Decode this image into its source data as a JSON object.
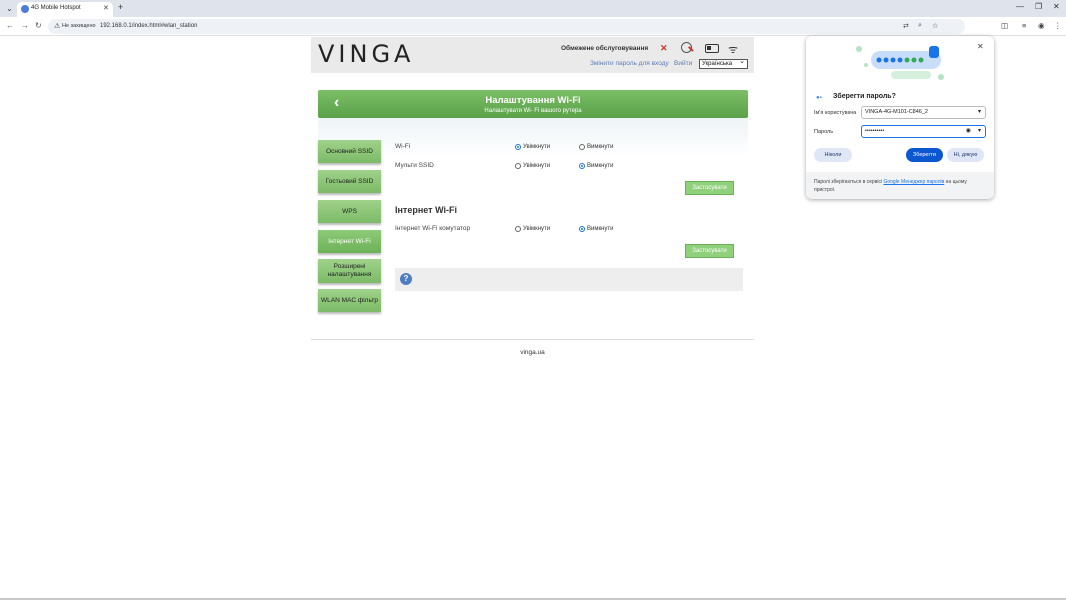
{
  "browser": {
    "tab_title": "4G Mobile Hotspot",
    "tab_close": "✕",
    "new_tab": "+",
    "security_label": "Не захищено",
    "url": "192.168.0.1/index.html#wlan_station",
    "win_min": "—",
    "win_max": "❐",
    "win_close": "✕"
  },
  "header": {
    "logo": "VINGA",
    "limited_service": "Обмежене обслуговування",
    "change_password": "Змінити пароль для входу",
    "logout": "Вийти",
    "language": "Українська"
  },
  "banner": {
    "title": "Налаштування Wi-Fi",
    "subtitle": "Налаштувати Wi- Fi вашого рутера"
  },
  "sidebar": {
    "items": [
      {
        "label": "Основний SSID"
      },
      {
        "label": "Гостьовий SSID"
      },
      {
        "label": "WPS"
      },
      {
        "label": "Інтернет Wi-Fi"
      },
      {
        "label": "Розширені налаштування"
      },
      {
        "label": "WLAN MAC фільтр"
      }
    ]
  },
  "wifi_settings": {
    "rows": [
      {
        "label": "Wi-Fi",
        "on": "Увімкнути",
        "off": "Вимкнути",
        "selected": "on"
      },
      {
        "label": "Мульти SSID",
        "on": "Увімкнути",
        "off": "Вимкнути",
        "selected": "off"
      }
    ],
    "apply": "Застосувати"
  },
  "internet_wifi": {
    "title": "Інтернет Wi-Fi",
    "row": {
      "label": "Інтернет Wi-Fi комутатор",
      "on": "Увімкнути",
      "off": "Вимкнути",
      "selected": "off"
    },
    "apply": "Застосувати"
  },
  "help": {
    "icon": "?"
  },
  "footer": {
    "text": "vinga.ua"
  },
  "password_popup": {
    "title": "Зберегти пароль?",
    "username_label": "Ім'я користувача",
    "username_value": "VINGA-4G-M101-C846_2",
    "password_label": "Пароль",
    "password_value": "••••••••••",
    "never": "Ніколи",
    "save": "Зберегти",
    "no_thanks": "Ні, дякую",
    "footer_prefix": "Паролі зберігаються в сервісі ",
    "footer_link": "Google Менеджер паролів",
    "footer_suffix": " на цьому пристрої."
  },
  "colors": {
    "accent_green": "#7cbb67",
    "link_blue": "#5b7db8",
    "chrome_blue": "#0b57d0"
  }
}
